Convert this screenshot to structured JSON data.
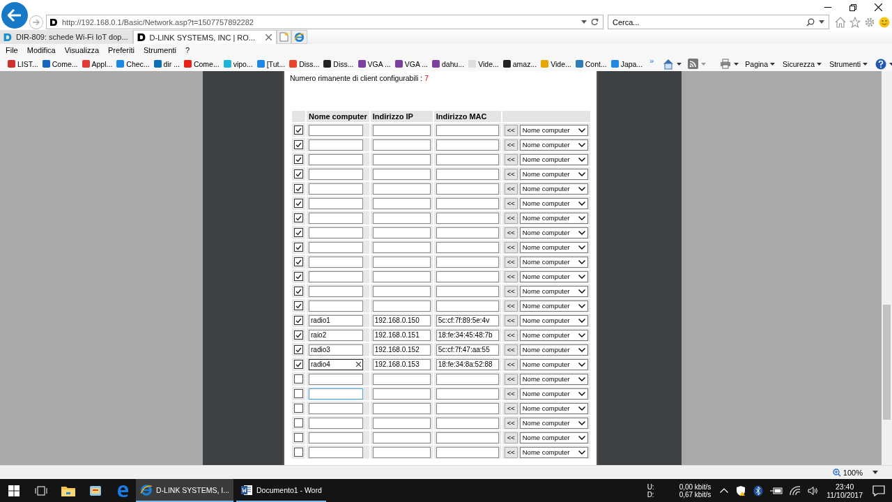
{
  "address_bar": {
    "url": "http://192.168.0.1/Basic/Network.asp?t=1507757892282"
  },
  "search": {
    "placeholder": "Cerca..."
  },
  "tabs": [
    {
      "label": "DIR-809: schede Wi-Fi IoT dop...",
      "selected": false
    },
    {
      "label": "D-LINK SYSTEMS, INC | RO...",
      "selected": true
    }
  ],
  "menu": [
    "File",
    "Modifica",
    "Visualizza",
    "Preferiti",
    "Strumenti",
    "?"
  ],
  "favorites": [
    "LIST...",
    "Come...",
    "Appl...",
    "Chec...",
    "dir ...",
    "Come...",
    "vipo...",
    "[Tut...",
    "Diss...",
    "Diss...",
    "VGA ...",
    "VGA ...",
    "dahu...",
    "Vide...",
    "amaz...",
    "Vide...",
    "Cont...",
    "Japa..."
  ],
  "favorites_overflow": "»",
  "command_bar": [
    "Pagina",
    "Sicurezza",
    "Strumenti"
  ],
  "page": {
    "remaining_label": "Numero rimanente di client configurabili :",
    "remaining_count": "7",
    "table": {
      "columns": [
        "Nome computer",
        "Indirizzo IP",
        "Indirizzo MAC"
      ],
      "rows": [
        {
          "checked": true,
          "editing": false,
          "focused": false,
          "copy": "<<",
          "select": "Nome computer"
        },
        {
          "checked": true,
          "editing": false,
          "focused": false,
          "copy": "<<",
          "select": "Nome computer"
        },
        {
          "checked": true,
          "editing": false,
          "focused": false,
          "copy": "<<",
          "select": "Nome computer"
        },
        {
          "checked": true,
          "editing": false,
          "focused": false,
          "copy": "<<",
          "select": "Nome computer"
        },
        {
          "checked": true,
          "editing": false,
          "focused": false,
          "copy": "<<",
          "select": "Nome computer"
        },
        {
          "checked": true,
          "editing": false,
          "focused": false,
          "copy": "<<",
          "select": "Nome computer"
        },
        {
          "checked": true,
          "editing": false,
          "focused": false,
          "copy": "<<",
          "select": "Nome computer"
        },
        {
          "checked": true,
          "editing": false,
          "focused": false,
          "copy": "<<",
          "select": "Nome computer"
        },
        {
          "checked": true,
          "editing": false,
          "focused": false,
          "copy": "<<",
          "select": "Nome computer"
        },
        {
          "checked": true,
          "editing": false,
          "focused": false,
          "copy": "<<",
          "select": "Nome computer"
        },
        {
          "checked": true,
          "editing": false,
          "focused": false,
          "copy": "<<",
          "select": "Nome computer"
        },
        {
          "checked": true,
          "editing": false,
          "focused": false,
          "copy": "<<",
          "select": "Nome computer"
        },
        {
          "checked": true,
          "editing": false,
          "focused": false,
          "copy": "<<",
          "select": "Nome computer"
        },
        {
          "checked": true,
          "editing": false,
          "focused": false,
          "name": "radio1",
          "ip": "192.168.0.150",
          "mac": "5c:cf:7f:89:5e:4v",
          "copy": "<<",
          "select": "Nome computer"
        },
        {
          "checked": true,
          "editing": false,
          "focused": false,
          "name": "raio2",
          "ip": "192.168.0.151",
          "mac": "18:fe:34:45:48:7b",
          "copy": "<<",
          "select": "Nome computer"
        },
        {
          "checked": true,
          "editing": false,
          "focused": false,
          "name": "radio3",
          "ip": "192.168.0.152",
          "mac": "5c:cf:7f:47:aa:55",
          "copy": "<<",
          "select": "Nome computer"
        },
        {
          "checked": true,
          "editing": true,
          "focused": false,
          "name": "radio4",
          "ip": "192.168.0.153",
          "mac": "18:fe:34:8a:52:88",
          "copy": "<<",
          "select": "Nome computer"
        },
        {
          "checked": false,
          "editing": false,
          "focused": false,
          "copy": "<<",
          "select": "Nome computer"
        },
        {
          "checked": false,
          "editing": false,
          "focused": true,
          "copy": "<<",
          "select": "Nome computer"
        },
        {
          "checked": false,
          "editing": false,
          "focused": false,
          "copy": "<<",
          "select": "Nome computer"
        },
        {
          "checked": false,
          "editing": false,
          "focused": false,
          "copy": "<<",
          "select": "Nome computer"
        },
        {
          "checked": false,
          "editing": false,
          "focused": false,
          "copy": "<<",
          "select": "Nome computer"
        },
        {
          "checked": false,
          "editing": false,
          "focused": false,
          "copy": "<<",
          "select": "Nome computer"
        }
      ]
    }
  },
  "status_bar": {
    "zoom": "100%"
  },
  "taskbar": {
    "apps": [
      {
        "kind": "browser",
        "label": "D-LINK SYSTEMS, I...",
        "selected": true
      },
      {
        "kind": "word",
        "label": "Documento1 - Word",
        "selected": false
      }
    ],
    "network": [
      {
        "label": "U:",
        "value": "0,00 kbit/s"
      },
      {
        "label": "D:",
        "value": "0,67 kbit/s"
      }
    ],
    "time": "23:40",
    "date": "11/10/2017"
  }
}
